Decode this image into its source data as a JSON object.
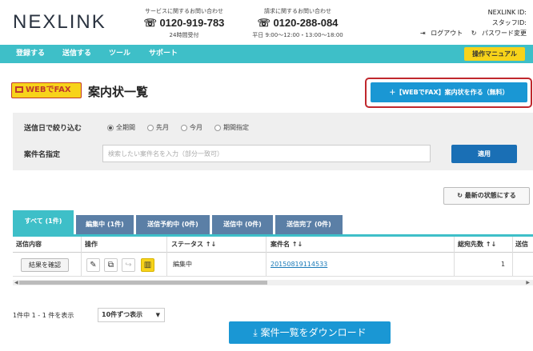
{
  "header": {
    "logo": "NEXLINK",
    "contact_service": {
      "caption": "サービスに関するお問い合わせ",
      "phone": "0120-919-783",
      "hours": "24時間受付"
    },
    "contact_billing": {
      "caption": "請求に関するお問い合わせ",
      "phone": "0120-288-084",
      "hours": "平日 9:00〜12:00・13:00〜18:00"
    },
    "user": {
      "id_label": "NEXLINK ID:",
      "staff_label": "スタッフID:",
      "logout": "ログアウト",
      "password": "パスワード変更"
    }
  },
  "nav": {
    "items": [
      "登録する",
      "送信する",
      "ツール",
      "サポート"
    ],
    "manual": "操作マニュアル"
  },
  "title": {
    "badge": "WEBでFAX",
    "page_title": "案内状一覧",
    "create_button": "＋【WEBでFAX】案内状を作る（無料）"
  },
  "filter": {
    "date_label": "送信日で絞り込む",
    "date_options": [
      {
        "label": "全期間",
        "selected": true
      },
      {
        "label": "先月",
        "selected": false
      },
      {
        "label": "今月",
        "selected": false
      },
      {
        "label": "期間指定",
        "selected": false
      }
    ],
    "name_label": "案件名指定",
    "name_placeholder": "検索したい案件名を入力（部分一致可）",
    "apply": "適用"
  },
  "refresh": "最新の状態にする",
  "tabs": [
    {
      "label": "すべて (1件)",
      "active": true
    },
    {
      "label": "編集中 (1件)",
      "active": false
    },
    {
      "label": "送信予約中 (0件)",
      "active": false
    },
    {
      "label": "送信中 (0件)",
      "active": false
    },
    {
      "label": "送信完了 (0件)",
      "active": false
    }
  ],
  "table": {
    "headers": [
      "送信内容",
      "操作",
      "ステータス ↑↓",
      "案件名 ↑↓",
      "総宛先数 ↑↓",
      "送信"
    ],
    "rows": [
      {
        "action": "結果を確認",
        "status": "編集中",
        "name": "20150819114533",
        "total": "1"
      }
    ]
  },
  "pagination": {
    "count_text": "1件中 1 - 1 件を表示",
    "per_page": "10件ずつ表示"
  },
  "download": "案件一覧をダウンロード",
  "colors": {
    "accent": "#3ebfc8",
    "primary": "#1a97d4",
    "highlight": "#f7d31a",
    "outline": "#c0272d"
  }
}
